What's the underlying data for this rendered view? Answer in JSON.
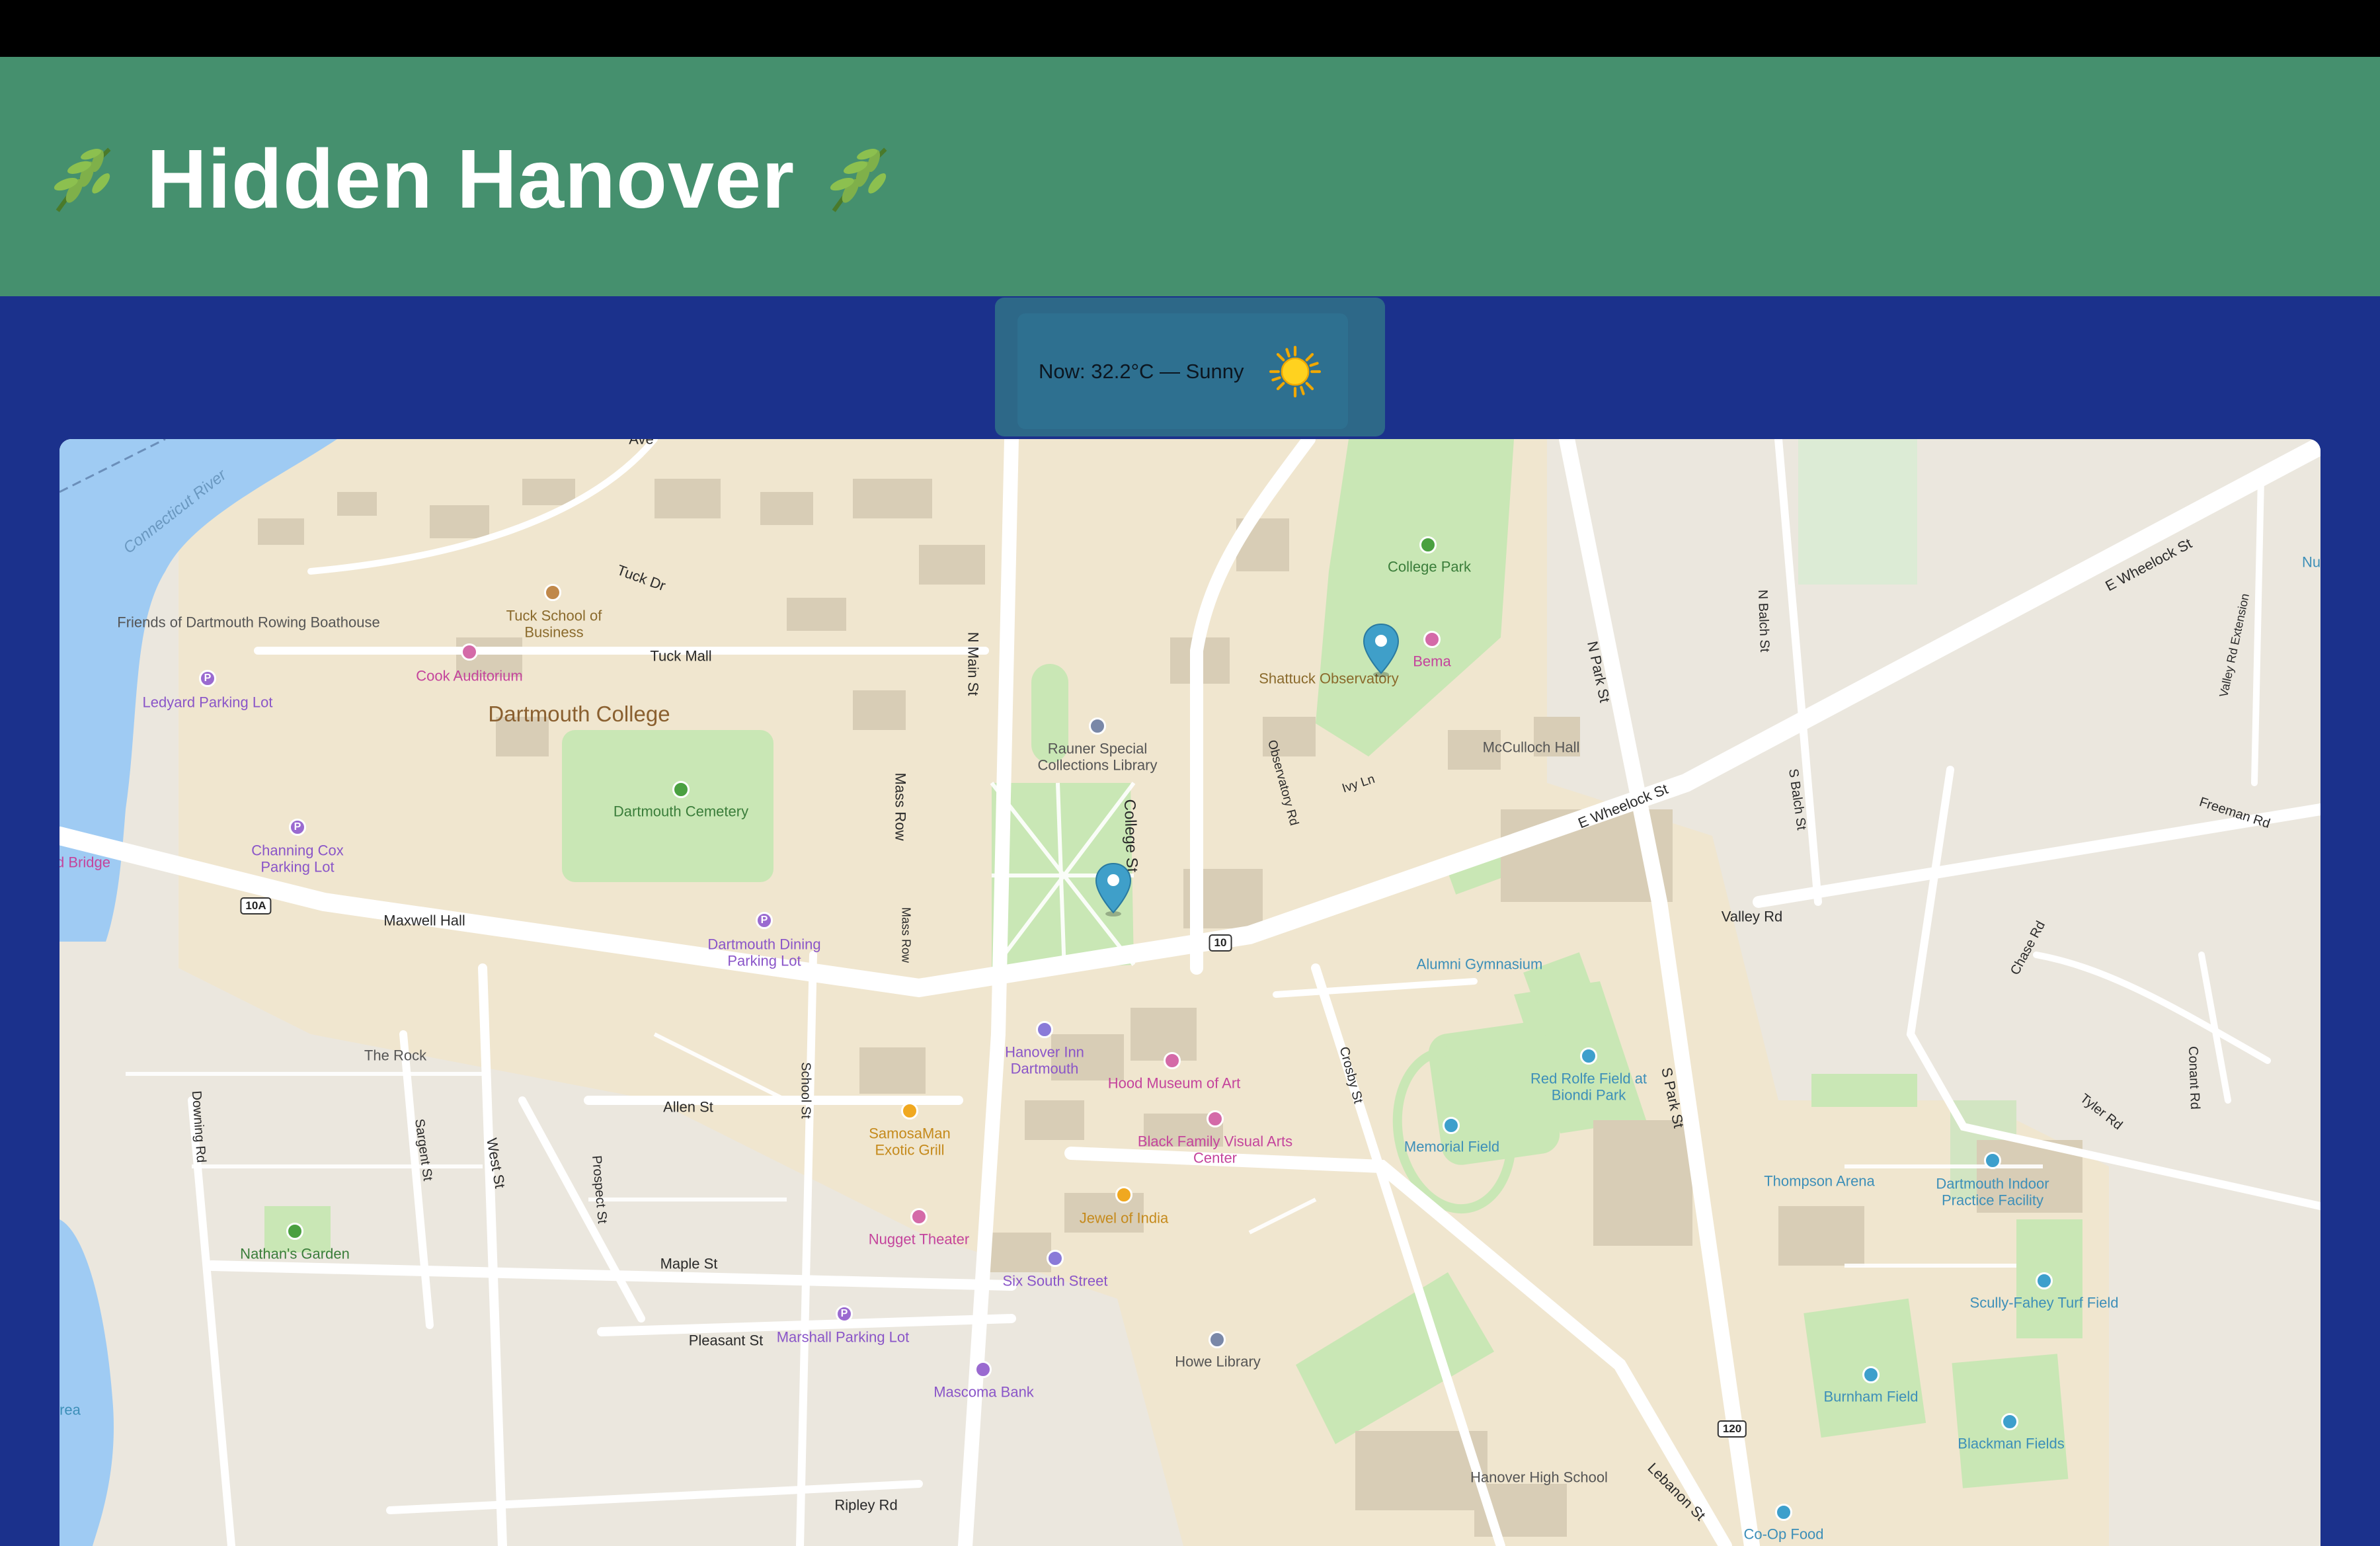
{
  "app": {
    "title": "Hidden Hanover",
    "title_icon": "leaf-icon"
  },
  "weather": {
    "text": "Now: 32.2°C — Sunny",
    "icon": "sun-icon"
  },
  "map": {
    "campus_label": "Dartmouth College",
    "river_label": "Connecticut River",
    "markers": [
      "Shattuck Observatory",
      "Dartmouth Green"
    ],
    "streets": [
      "Tuck Dr",
      "Tuck Mall",
      "N Main St",
      "Mass Row",
      "College St",
      "Observatory Rd",
      "Ivy Ln",
      "E Wheelock St",
      "N Park St",
      "N Balch St",
      "S Balch St",
      "Valley Rd",
      "Freeman Rd",
      "Chase Rd",
      "Valley Rd Extension",
      "Tyler Rd",
      "Conant Rd",
      "Crosby St",
      "S Park St",
      "School St",
      "Allen St",
      "West St",
      "Prospect St",
      "Sargent St",
      "Downing Rd",
      "Maple St",
      "Pleasant St",
      "Ripley Rd",
      "Lebanon St",
      "Maxwell Hall",
      "Ave"
    ],
    "pois": {
      "boathouse": "Friends of Dartmouth Rowing Boathouse",
      "tuck": "Tuck School of Business",
      "cook": "Cook Auditorium",
      "ledyard": "Ledyard Parking Lot",
      "cemetery": "Dartmouth Cemetery",
      "channing": "Channing Cox Parking Lot",
      "bridge": "d Bridge",
      "maxwell": "Maxwell Hall",
      "dining": "Dartmouth Dining Parking Lot",
      "rauner": "Rauner Special Collections Library",
      "college_park": "College Park",
      "bema": "Bema",
      "shattuck": "Shattuck Observatory",
      "mcculloch": "McCulloch Hall",
      "alumni": "Alumni Gymnasium",
      "redrolfe": "Red Rolfe Field at Biondi Park",
      "memorial": "Memorial Field",
      "hanover_inn": "Hanover Inn Dartmouth",
      "hood": "Hood Museum of Art",
      "black": "Black Family Visual Arts Center",
      "samosaman": "SamosaMan Exotic Grill",
      "jewel": "Jewel of India",
      "nugget": "Nugget Theater",
      "six_south": "Six South Street",
      "marshall": "Marshall Parking Lot",
      "mascoma": "Mascoma Bank",
      "howe": "Howe Library",
      "thompson": "Thompson Arena",
      "indoor": "Dartmouth Indoor Practice Facility",
      "scully": "Scully-Fahey Turf Field",
      "burnham": "Burnham Field",
      "blackman": "Blackman Fields",
      "hhs": "Hanover High School",
      "coop": "Co-Op Food",
      "rock": "The Rock",
      "nathan": "Nathan's Garden",
      "nu": "Nu",
      "area": "rea"
    },
    "shields": [
      "10A",
      "10",
      "120"
    ]
  }
}
